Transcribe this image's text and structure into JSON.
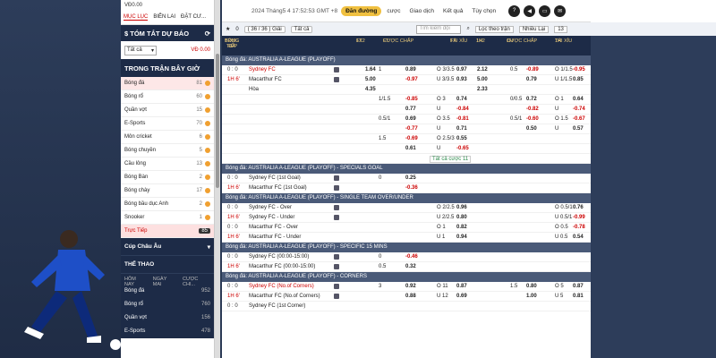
{
  "sidebar": {
    "balance": "VĐ0.00",
    "tabs": [
      "MỤC LỤC",
      "BIÊN LAI",
      "ĐẶT CƯ..."
    ],
    "summary_title": "$ TÓM TẮT DỰ BÁO",
    "filter_value": "Tất cả",
    "filter_amount": "VĐ 0.00",
    "live_title": "TRONG TRẬN BÂY GIỜ",
    "sports": [
      {
        "label": "Bóng đá",
        "count": "81"
      },
      {
        "label": "Bóng rổ",
        "count": "60"
      },
      {
        "label": "Quần vợt",
        "count": "15"
      },
      {
        "label": "E-Sports",
        "count": "70"
      },
      {
        "label": "Môn cricket",
        "count": "6"
      },
      {
        "label": "Bóng chuyền",
        "count": "5"
      },
      {
        "label": "Cầu lông",
        "count": "13"
      },
      {
        "label": "Bóng Bàn",
        "count": "2"
      },
      {
        "label": "Bóng chày",
        "count": "17"
      },
      {
        "label": "Bóng bầu dục Anh",
        "count": "2"
      },
      {
        "label": "Snooker",
        "count": "1"
      }
    ],
    "live_label": "Trực Tiếp",
    "live_count": "85",
    "cup_label": "Cúp Châu Âu",
    "sports_title": "THỂ THAO",
    "subtabs": [
      "HÔM NAY",
      "NGÀY MAI",
      "CƯỢC CHI..."
    ],
    "sports2": [
      {
        "label": "Bóng đá",
        "count": "952"
      },
      {
        "label": "Bóng rổ",
        "count": "760"
      },
      {
        "label": "Quần vợt",
        "count": "156"
      },
      {
        "label": "E-Sports",
        "count": "478"
      }
    ]
  },
  "topbar": {
    "time": "2024 Tháng5 4 17:52:53 GMT +8",
    "login": "Đăn đường",
    "nav": [
      "cược",
      "Giao dịch",
      "Kết quả",
      "Tùy chọn"
    ],
    "badge": "228"
  },
  "tools": {
    "count": "0",
    "matches": "( 36 / 36 ) Giải",
    "all": "Tất cả",
    "search_placeholder": "Tìm kiếm đội",
    "filter": "Lọc theo trận",
    "more": "Nhiều Lại",
    "count2": "13"
  },
  "columns": {
    "c0a": "BÓNG ĐÁ",
    "c0b": "TRỰC TIẾP",
    "c1a": "FT",
    "c1b": "1X2",
    "c2a": "FT",
    "c2b": "CƯỢC CHẤP",
    "c3a": "FT",
    "c3b": "TÀI XỈU",
    "c4a": "1H",
    "c4b": "1X2",
    "c5a": "1H",
    "c5b": "CƯỢC CHẤP",
    "c6a": "1H",
    "c6b": "TÀI XỈU"
  },
  "blocks": [
    {
      "league": "Bóng đá: AUSTRALIA A-LEAGUE (PLAYOFF)",
      "rows": [
        {
          "score": "0 : 0",
          "team": "Sydney FC",
          "red": true,
          "c1": "1.64",
          "c2a": "1",
          "c2b": "0.89",
          "c3a": "O 3/3.5",
          "c3b": "0.97",
          "c4": "2.12",
          "c5a": "0.5",
          "c5b": "-0.89",
          "c6a": "O 1/1.5",
          "c6b": "-0.95"
        },
        {
          "score": "1H 6'",
          "team": "Macarthur FC",
          "red": false,
          "c1": "5.00",
          "c2a": "",
          "c2b": "-0.97",
          "c3a": "U 3/3.5",
          "c3b": "0.93",
          "c4": "5.00",
          "c5a": "",
          "c5b": "0.79",
          "c6a": "U 1/1.5",
          "c6b": "0.85"
        },
        {
          "score": "",
          "team": "Hòa",
          "red": false,
          "c1": "4.35",
          "c2a": "",
          "c2b": "",
          "c3a": "",
          "c3b": "",
          "c4": "2.33",
          "c5a": "",
          "c5b": "",
          "c6a": "",
          "c6b": ""
        },
        {
          "score": "",
          "team": "",
          "red": false,
          "c1": "",
          "c2a": "1/1.5",
          "c2b": "-0.85",
          "c3a": "O 3",
          "c3b": "0.74",
          "c4": "",
          "c5a": "0/0.5",
          "c5b": "0.72",
          "c6a": "O 1",
          "c6b": "0.64"
        },
        {
          "score": "",
          "team": "",
          "red": false,
          "c1": "",
          "c2a": "",
          "c2b": "0.77",
          "c3a": "U",
          "c3b": "-0.84",
          "c4": "",
          "c5a": "",
          "c5b": "-0.82",
          "c6a": "U",
          "c6b": "-0.74"
        },
        {
          "score": "",
          "team": "",
          "red": false,
          "c1": "",
          "c2a": "0.5/1",
          "c2b": "0.69",
          "c3a": "O 3.5",
          "c3b": "-0.81",
          "c4": "",
          "c5a": "0.5/1",
          "c5b": "-0.60",
          "c6a": "O 1.5",
          "c6b": "-0.67"
        },
        {
          "score": "",
          "team": "",
          "red": false,
          "c1": "",
          "c2a": "",
          "c2b": "-0.77",
          "c3a": "U",
          "c3b": "0.71",
          "c4": "",
          "c5a": "",
          "c5b": "0.50",
          "c6a": "U",
          "c6b": "0.57"
        },
        {
          "score": "",
          "team": "",
          "red": false,
          "c1": "",
          "c2a": "1.5",
          "c2b": "-0.69",
          "c3a": "O 2.5/3",
          "c3b": "0.55",
          "c4": "",
          "c5a": "",
          "c5b": "",
          "c6a": "",
          "c6b": ""
        },
        {
          "score": "",
          "team": "",
          "red": false,
          "c1": "",
          "c2a": "",
          "c2b": "0.61",
          "c3a": "U",
          "c3b": "-0.65",
          "c4": "",
          "c5a": "",
          "c5b": "",
          "c6a": "",
          "c6b": ""
        }
      ],
      "all_bets": "Tất cả cược 11"
    },
    {
      "league": "Bóng đá: AUSTRALIA A-LEAGUE (PLAYOFF) - SPECIALS GOAL",
      "rows": [
        {
          "score": "0 : 0",
          "team": "Sydney FC (1st Goal)",
          "red": false,
          "c1": "",
          "c2a": "0",
          "c2b": "0.25",
          "c3a": "",
          "c3b": "",
          "c4": "",
          "c5a": "",
          "c5b": "",
          "c6a": "",
          "c6b": ""
        },
        {
          "score": "1H 6'",
          "team": "Macarthur FC (1st Goal)",
          "red": false,
          "c1": "",
          "c2a": "",
          "c2b": "-0.36",
          "c3a": "",
          "c3b": "",
          "c4": "",
          "c5a": "",
          "c5b": "",
          "c6a": "",
          "c6b": ""
        }
      ]
    },
    {
      "league": "Bóng đá: AUSTRALIA A-LEAGUE (PLAYOFF) - SINGLE TEAM OVER/UNDER",
      "rows": [
        {
          "score": "0 : 0",
          "team": "Sydney FC - Over",
          "red": false,
          "c1": "",
          "c2a": "",
          "c2b": "",
          "c3a": "O 2/2.5",
          "c3b": "0.96",
          "c4": "",
          "c5a": "",
          "c5b": "",
          "c6a": "O 0.5/1",
          "c6b": "0.76"
        },
        {
          "score": "1H 6'",
          "team": "Sydney FC - Under",
          "red": false,
          "c1": "",
          "c2a": "",
          "c2b": "",
          "c3a": "U 2/2.5",
          "c3b": "0.80",
          "c4": "",
          "c5a": "",
          "c5b": "",
          "c6a": "U 0.5/1",
          "c6b": "-0.99"
        },
        {
          "score": "0 : 0",
          "team": "Macarthur FC - Over",
          "red": false,
          "c1": "",
          "c2a": "",
          "c2b": "",
          "c3a": "O 1",
          "c3b": "0.82",
          "c4": "",
          "c5a": "",
          "c5b": "",
          "c6a": "O 0.5",
          "c6b": "-0.78"
        },
        {
          "score": "1H 6'",
          "team": "Macarthur FC - Under",
          "red": false,
          "c1": "",
          "c2a": "",
          "c2b": "",
          "c3a": "U 1",
          "c3b": "0.94",
          "c4": "",
          "c5a": "",
          "c5b": "",
          "c6a": "U 0.5",
          "c6b": "0.54"
        }
      ]
    },
    {
      "league": "Bóng đá: AUSTRALIA A-LEAGUE (PLAYOFF) - SPECIFIC 15 MINS",
      "rows": [
        {
          "score": "0 : 0",
          "team": "Sydney FC (00:00-15:00)",
          "red": false,
          "c1": "",
          "c2a": "0",
          "c2b": "-0.46",
          "c3a": "",
          "c3b": "",
          "c4": "",
          "c5a": "",
          "c5b": "",
          "c6a": "",
          "c6b": ""
        },
        {
          "score": "1H 6'",
          "team": "Macarthur FC (00:00-15:00)",
          "red": false,
          "c1": "",
          "c2a": "0.5",
          "c2b": "0.32",
          "c3a": "",
          "c3b": "",
          "c4": "",
          "c5a": "",
          "c5b": "",
          "c6a": "",
          "c6b": ""
        }
      ]
    },
    {
      "league": "Bóng đá: AUSTRALIA A-LEAGUE (PLAYOFF) - CORNERS",
      "rows": [
        {
          "score": "0 : 0",
          "team": "Sydney FC (No.of Corners)",
          "red": true,
          "c1": "",
          "c2a": "3",
          "c2b": "0.92",
          "c3a": "O 11",
          "c3b": "0.87",
          "c4": "",
          "c5a": "1.5",
          "c5b": "0.80",
          "c6a": "O 5",
          "c6b": "0.87"
        },
        {
          "score": "1H 6'",
          "team": "Macarthur FC (No.of Corners)",
          "red": false,
          "c1": "",
          "c2a": "",
          "c2b": "0.88",
          "c3a": "U 12",
          "c3b": "0.69",
          "c4": "",
          "c5a": "",
          "c5b": "1.00",
          "c6a": "U 5",
          "c6b": "0.81"
        },
        {
          "score": "0 : 0",
          "team": "Sydney FC (1st Corner)",
          "red": false,
          "c1": "",
          "c2a": "",
          "c2b": "",
          "c3a": "",
          "c3b": "",
          "c4": "",
          "c5a": "",
          "c5b": "",
          "c6a": "",
          "c6b": ""
        }
      ]
    }
  ]
}
